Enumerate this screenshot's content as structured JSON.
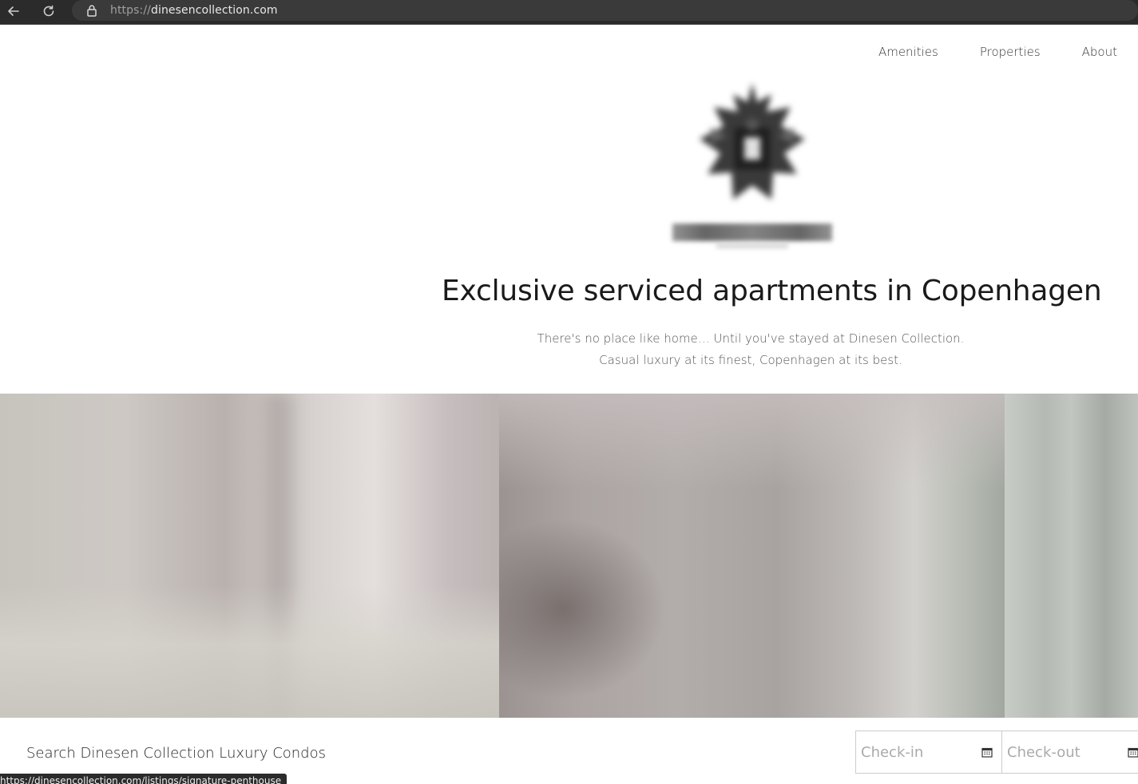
{
  "browser": {
    "url_scheme": "https://",
    "url_host": "dinesencollection.com"
  },
  "nav": {
    "items": [
      {
        "label": "Amenities"
      },
      {
        "label": "Properties"
      },
      {
        "label": "About"
      }
    ]
  },
  "hero": {
    "headline": "Exclusive serviced apartments in Copenhagen",
    "subline_1": "There's no place like home… Until you've stayed at Dinesen Collection.",
    "subline_2": "Casual luxury at its finest, Copenhagen at its best."
  },
  "search": {
    "title": "Search Dinesen Collection Luxury Condos",
    "checkin_placeholder": "Check-in",
    "checkout_placeholder": "Check-out"
  },
  "status_bar": {
    "link_preview": "https://dinesencollection.com/listings/signature-penthouse"
  },
  "icons": {
    "back": "back-arrow-icon",
    "reload": "reload-icon",
    "lock": "lock-icon",
    "calendar": "calendar-icon"
  }
}
